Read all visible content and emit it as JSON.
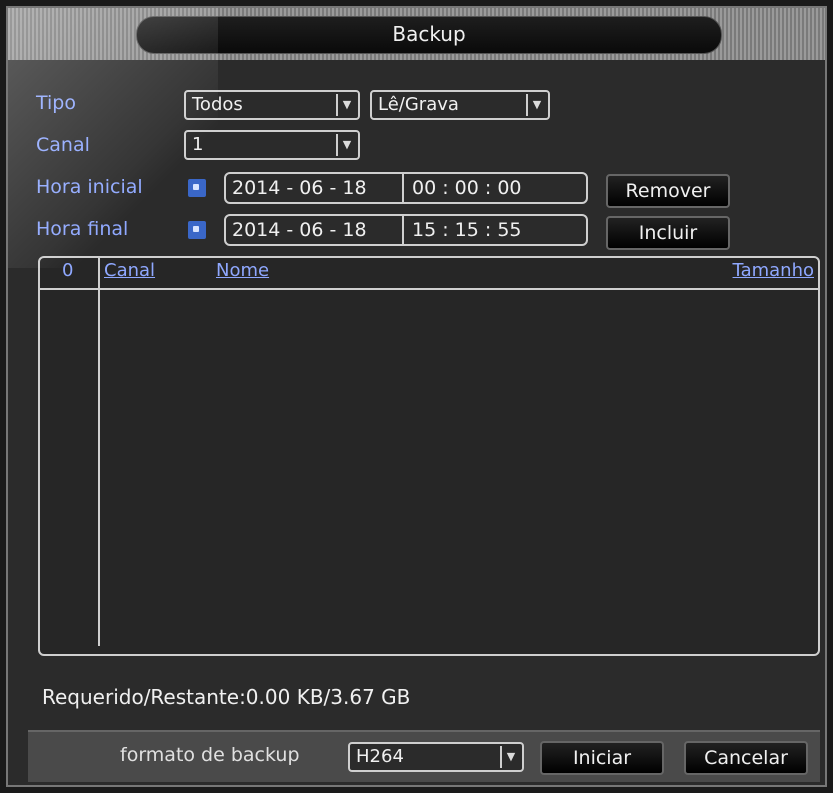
{
  "window": {
    "title": "Backup"
  },
  "filters": {
    "tipo_label": "Tipo",
    "tipo_value": "Todos",
    "mode_value": "Lê/Grava",
    "canal_label": "Canal",
    "canal_value": "1",
    "hora_inicial_label": "Hora inicial",
    "hora_inicial_date": "2014 - 06 - 18",
    "hora_inicial_time": "00 : 00 : 00",
    "hora_final_label": "Hora final",
    "hora_final_date": "2014 - 06 - 18",
    "hora_final_time": "15 : 15 : 55"
  },
  "buttons": {
    "remover": "Remover",
    "incluir": "Incluir",
    "iniciar": "Iniciar",
    "cancelar": "Cancelar"
  },
  "list": {
    "columns": [
      "0",
      "Canal",
      "Nome",
      "Tamanho"
    ],
    "rows": []
  },
  "status": {
    "requirement": "Requerido/Restante:0.00 KB/3.67 GB"
  },
  "backup": {
    "format_label": "formato de backup",
    "format_value": "H264"
  },
  "colors": {
    "accent": "#8fa8ff",
    "checkbox": "#3a67c8"
  }
}
